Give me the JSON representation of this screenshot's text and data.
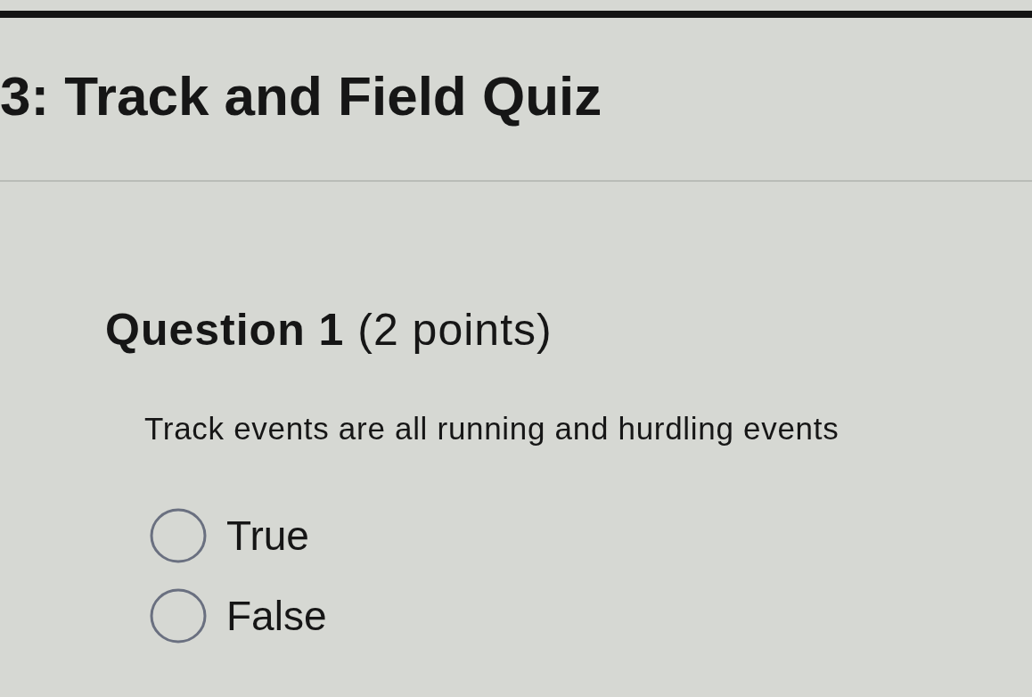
{
  "quiz": {
    "title": "3: Track and Field Quiz"
  },
  "question": {
    "heading": "**Question 1** (2 points)",
    "prompt": "Track events are all running and hurdling events",
    "options": [
      {
        "label": "True",
        "selected": false
      },
      {
        "label": "False",
        "selected": false
      }
    ]
  }
}
